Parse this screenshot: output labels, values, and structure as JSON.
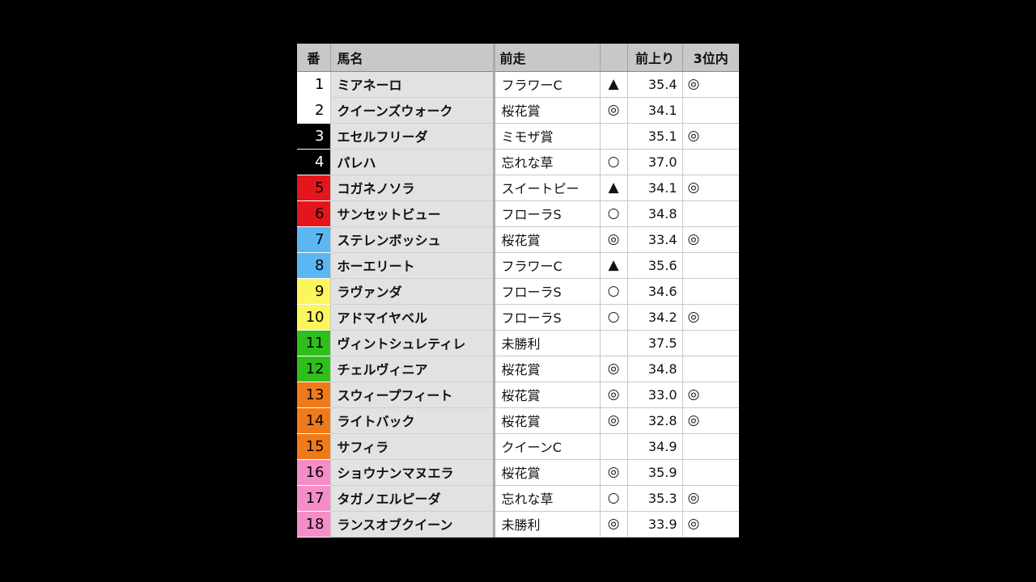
{
  "header": {
    "num": "番",
    "name": "馬名",
    "prev_race": "前走",
    "mark": "",
    "last3f": "前上り",
    "top3": "3位内"
  },
  "colors": {
    "waku1": "#ffffff",
    "waku2": "#000000",
    "waku3": "#e4161c",
    "waku4": "#5ab7f2",
    "waku5": "#fcf55e",
    "waku6": "#2fbf1a",
    "waku7": "#f07a1a",
    "waku8": "#f58ec6"
  },
  "rows": [
    {
      "num": "1",
      "name": "ミアネーロ",
      "prev": "フラワーC",
      "mark": "▲",
      "time": "35.4",
      "top3": "◎",
      "bg": "#ffffff",
      "fg": "#000000"
    },
    {
      "num": "2",
      "name": "クイーンズウォーク",
      "prev": "桜花賞",
      "mark": "◎",
      "time": "34.1",
      "top3": "",
      "bg": "#ffffff",
      "fg": "#000000"
    },
    {
      "num": "3",
      "name": "エセルフリーダ",
      "prev": "ミモザ賞",
      "mark": "",
      "time": "35.1",
      "top3": "◎",
      "bg": "#000000",
      "fg": "#ffffff"
    },
    {
      "num": "4",
      "name": "パレハ",
      "prev": "忘れな草",
      "mark": "○",
      "time": "37.0",
      "top3": "",
      "bg": "#000000",
      "fg": "#ffffff"
    },
    {
      "num": "5",
      "name": "コガネノソラ",
      "prev": "スイートピー",
      "mark": "▲",
      "time": "34.1",
      "top3": "◎",
      "bg": "#e4161c",
      "fg": "#000000"
    },
    {
      "num": "6",
      "name": "サンセットビュー",
      "prev": "フローラS",
      "mark": "○",
      "time": "34.8",
      "top3": "",
      "bg": "#e4161c",
      "fg": "#000000"
    },
    {
      "num": "7",
      "name": "ステレンボッシュ",
      "prev": "桜花賞",
      "mark": "◎",
      "time": "33.4",
      "top3": "◎",
      "bg": "#5ab7f2",
      "fg": "#000000"
    },
    {
      "num": "8",
      "name": "ホーエリート",
      "prev": "フラワーC",
      "mark": "▲",
      "time": "35.6",
      "top3": "",
      "bg": "#5ab7f2",
      "fg": "#000000"
    },
    {
      "num": "9",
      "name": "ラヴァンダ",
      "prev": "フローラS",
      "mark": "○",
      "time": "34.6",
      "top3": "",
      "bg": "#fcf55e",
      "fg": "#000000"
    },
    {
      "num": "10",
      "name": "アドマイヤベル",
      "prev": "フローラS",
      "mark": "○",
      "time": "34.2",
      "top3": "◎",
      "bg": "#fcf55e",
      "fg": "#000000"
    },
    {
      "num": "11",
      "name": "ヴィントシュレティレ",
      "prev": "未勝利",
      "mark": "",
      "time": "37.5",
      "top3": "",
      "bg": "#2fbf1a",
      "fg": "#000000"
    },
    {
      "num": "12",
      "name": "チェルヴィニア",
      "prev": "桜花賞",
      "mark": "◎",
      "time": "34.8",
      "top3": "",
      "bg": "#2fbf1a",
      "fg": "#000000"
    },
    {
      "num": "13",
      "name": "スウィープフィート",
      "prev": "桜花賞",
      "mark": "◎",
      "time": "33.0",
      "top3": "◎",
      "bg": "#f07a1a",
      "fg": "#000000"
    },
    {
      "num": "14",
      "name": "ライトバック",
      "prev": "桜花賞",
      "mark": "◎",
      "time": "32.8",
      "top3": "◎",
      "bg": "#f07a1a",
      "fg": "#000000"
    },
    {
      "num": "15",
      "name": "サフィラ",
      "prev": "クイーンC",
      "mark": "",
      "time": "34.9",
      "top3": "",
      "bg": "#f07a1a",
      "fg": "#000000"
    },
    {
      "num": "16",
      "name": "ショウナンマヌエラ",
      "prev": "桜花賞",
      "mark": "◎",
      "time": "35.9",
      "top3": "",
      "bg": "#f58ec6",
      "fg": "#000000"
    },
    {
      "num": "17",
      "name": "タガノエルピーダ",
      "prev": "忘れな草",
      "mark": "○",
      "time": "35.3",
      "top3": "◎",
      "bg": "#f58ec6",
      "fg": "#000000"
    },
    {
      "num": "18",
      "name": "ランスオブクイーン",
      "prev": "未勝利",
      "mark": "◎",
      "time": "33.9",
      "top3": "◎",
      "bg": "#f58ec6",
      "fg": "#000000"
    }
  ]
}
